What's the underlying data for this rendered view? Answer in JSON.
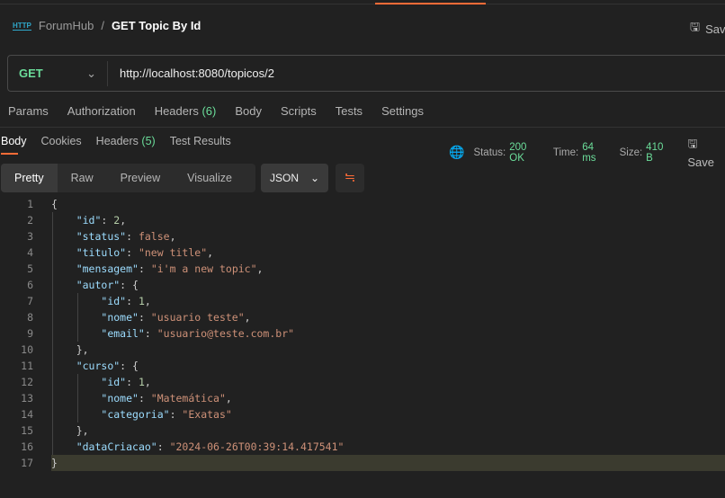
{
  "header": {
    "icon": "http-icon",
    "collection": "ForumHub",
    "separator": "/",
    "request_name": "GET Topic By Id",
    "save_label": "Save"
  },
  "request": {
    "method": "GET",
    "url": "http://localhost:8080/topicos/2"
  },
  "request_tabs": [
    {
      "label": "Params"
    },
    {
      "label": "Authorization"
    },
    {
      "label": "Headers",
      "count": "(6)"
    },
    {
      "label": "Body"
    },
    {
      "label": "Scripts"
    },
    {
      "label": "Tests"
    },
    {
      "label": "Settings"
    }
  ],
  "response_tabs": [
    {
      "label": "Body",
      "active": true
    },
    {
      "label": "Cookies"
    },
    {
      "label": "Headers",
      "count": "(5)"
    },
    {
      "label": "Test Results"
    }
  ],
  "response_meta": {
    "status_label": "Status:",
    "status": "200 OK",
    "time_label": "Time:",
    "time": "64 ms",
    "size_label": "Size:",
    "size": "410 B",
    "save_label": "Save"
  },
  "view_modes": [
    "Pretty",
    "Raw",
    "Preview",
    "Visualize"
  ],
  "active_view": "Pretty",
  "format": "JSON",
  "colors": {
    "accent": "#ff6c37",
    "success": "#6bdd9a",
    "key": "#9cdcfe",
    "string": "#ce9178",
    "number": "#b5cea8"
  },
  "code_lines": [
    [
      [
        "p",
        "{"
      ]
    ],
    [
      [
        "p",
        "    "
      ],
      [
        "k",
        "\"id\""
      ],
      [
        "p",
        ": "
      ],
      [
        "n",
        "2"
      ],
      [
        "p",
        ","
      ]
    ],
    [
      [
        "p",
        "    "
      ],
      [
        "k",
        "\"status\""
      ],
      [
        "p",
        ": "
      ],
      [
        "b",
        "false"
      ],
      [
        "p",
        ","
      ]
    ],
    [
      [
        "p",
        "    "
      ],
      [
        "k",
        "\"titulo\""
      ],
      [
        "p",
        ": "
      ],
      [
        "s",
        "\"new title\""
      ],
      [
        "p",
        ","
      ]
    ],
    [
      [
        "p",
        "    "
      ],
      [
        "k",
        "\"mensagem\""
      ],
      [
        "p",
        ": "
      ],
      [
        "s",
        "\"i'm a new topic\""
      ],
      [
        "p",
        ","
      ]
    ],
    [
      [
        "p",
        "    "
      ],
      [
        "k",
        "\"autor\""
      ],
      [
        "p",
        ": {"
      ]
    ],
    [
      [
        "p",
        "        "
      ],
      [
        "k",
        "\"id\""
      ],
      [
        "p",
        ": "
      ],
      [
        "n",
        "1"
      ],
      [
        "p",
        ","
      ]
    ],
    [
      [
        "p",
        "        "
      ],
      [
        "k",
        "\"nome\""
      ],
      [
        "p",
        ": "
      ],
      [
        "s",
        "\"usuario teste\""
      ],
      [
        "p",
        ","
      ]
    ],
    [
      [
        "p",
        "        "
      ],
      [
        "k",
        "\"email\""
      ],
      [
        "p",
        ": "
      ],
      [
        "s",
        "\"usuario@teste.com.br\""
      ]
    ],
    [
      [
        "p",
        "    },"
      ]
    ],
    [
      [
        "p",
        "    "
      ],
      [
        "k",
        "\"curso\""
      ],
      [
        "p",
        ": {"
      ]
    ],
    [
      [
        "p",
        "        "
      ],
      [
        "k",
        "\"id\""
      ],
      [
        "p",
        ": "
      ],
      [
        "n",
        "1"
      ],
      [
        "p",
        ","
      ]
    ],
    [
      [
        "p",
        "        "
      ],
      [
        "k",
        "\"nome\""
      ],
      [
        "p",
        ": "
      ],
      [
        "s",
        "\"Matemática\""
      ],
      [
        "p",
        ","
      ]
    ],
    [
      [
        "p",
        "        "
      ],
      [
        "k",
        "\"categoria\""
      ],
      [
        "p",
        ": "
      ],
      [
        "s",
        "\"Exatas\""
      ]
    ],
    [
      [
        "p",
        "    },"
      ]
    ],
    [
      [
        "p",
        "    "
      ],
      [
        "k",
        "\"dataCriacao\""
      ],
      [
        "p",
        ": "
      ],
      [
        "s",
        "\"2024-06-26T00:39:14.417541\""
      ]
    ],
    [
      [
        "p",
        "}"
      ]
    ]
  ]
}
